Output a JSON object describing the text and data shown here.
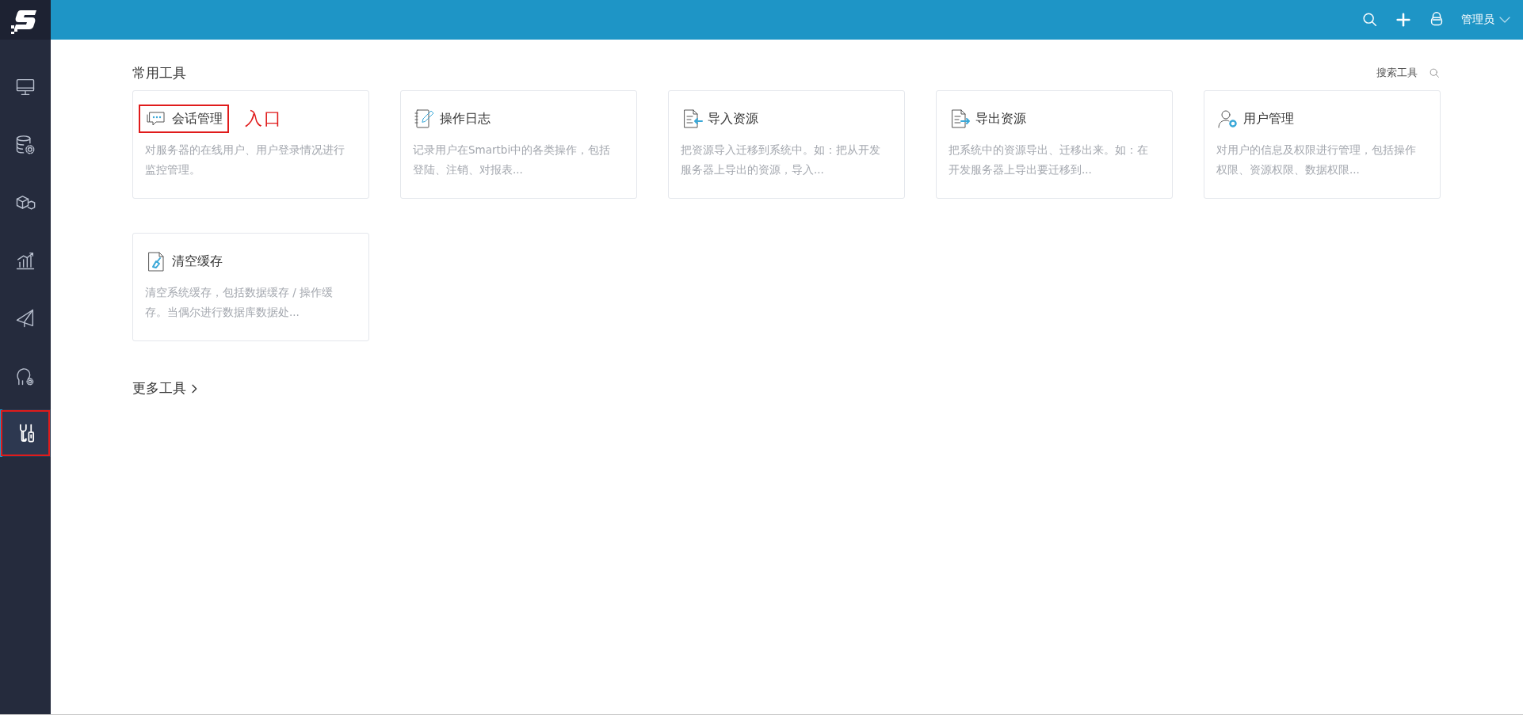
{
  "sidebar": {
    "items": [
      {
        "selected": false,
        "annotated": false
      },
      {
        "selected": false,
        "annotated": false
      },
      {
        "selected": false,
        "annotated": false
      },
      {
        "selected": false,
        "annotated": false
      },
      {
        "selected": false,
        "annotated": false
      },
      {
        "selected": false,
        "annotated": false
      },
      {
        "selected": true,
        "annotated": true
      }
    ]
  },
  "top_bar": {
    "user": "管理员"
  },
  "section_title": "常用工具",
  "search": {
    "label": "搜索工具"
  },
  "tools": [
    {
      "title": "会话管理",
      "description": "对服务器的在线用户、用户登录情况进行监控管理。",
      "annotated": true,
      "annotation": "入口"
    },
    {
      "title": "操作日志",
      "description": "记录用户在Smartbi中的各类操作，包括登陆、注销、对报表...",
      "annotated": false
    },
    {
      "title": "导入资源",
      "description": "把资源导入迁移到系统中。如：把从开发服务器上导出的资源，导入...",
      "annotated": false
    },
    {
      "title": "导出资源",
      "description": "把系统中的资源导出、迁移出来。如：在开发服务器上导出要迁移到...",
      "annotated": false
    },
    {
      "title": "用户管理",
      "description": "对用户的信息及权限进行管理，包括操作权限、资源权限、数据权限...",
      "annotated": false
    },
    {
      "title": "清空缓存",
      "description": "清空系统缓存，包括数据缓存 / 操作缓存。当偶尔进行数据库数据处...",
      "annotated": false
    }
  ],
  "more_tools": "更多工具"
}
